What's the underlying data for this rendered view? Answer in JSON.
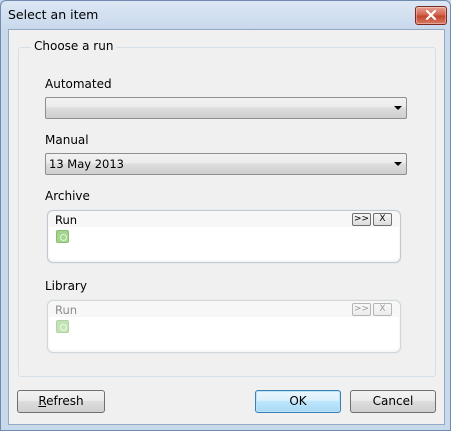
{
  "window": {
    "title": "Select an item"
  },
  "group": {
    "title": "Choose a run"
  },
  "automated": {
    "label": "Automated",
    "value": ""
  },
  "manual": {
    "label": "Manual",
    "value": "13 May 2013"
  },
  "archive": {
    "label": "Archive",
    "header": "Run",
    "add_button": ">>",
    "remove_button": "X",
    "item_icon": "add-circle-icon"
  },
  "library": {
    "label": "Library",
    "header": "Run",
    "add_button": ">>",
    "remove_button": "X",
    "item_icon": "add-circle-icon",
    "disabled": true
  },
  "buttons": {
    "refresh_prefix": "R",
    "refresh_rest": "efresh",
    "ok": "OK",
    "cancel": "Cancel"
  }
}
